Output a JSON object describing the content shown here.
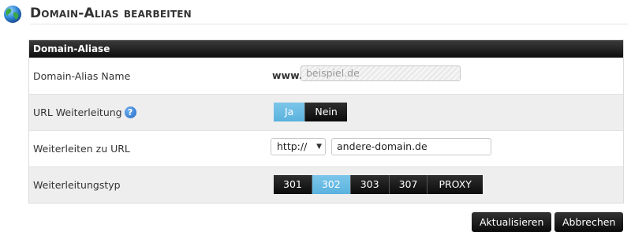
{
  "page": {
    "title": "Domain-Alias bearbeiten"
  },
  "panel": {
    "title": "Domain-Aliase"
  },
  "rows": {
    "alias_name": {
      "label": "Domain-Alias Name",
      "prefix": "www.",
      "value": "beispiel.de"
    },
    "url_redirect": {
      "label": "URL Weiterleitung",
      "help": "?",
      "options": [
        "Ja",
        "Nein"
      ],
      "selected": "Ja"
    },
    "redirect_url": {
      "label": "Weiterleiten zu URL",
      "protocol": "http://",
      "value": "andere-domain.de"
    },
    "redirect_type": {
      "label": "Weiterleitungstyp",
      "options": [
        "301",
        "302",
        "303",
        "307",
        "PROXY"
      ],
      "selected": "302"
    }
  },
  "actions": {
    "update": "Aktualisieren",
    "cancel": "Abbrechen"
  },
  "colors": {
    "active_segment": "#6bbce3",
    "dark_button": "#111111",
    "alt_row": "#eeeeee"
  },
  "icons": {
    "header": "globe-icon",
    "help": "help-icon",
    "select": "chevron-down-icon"
  }
}
